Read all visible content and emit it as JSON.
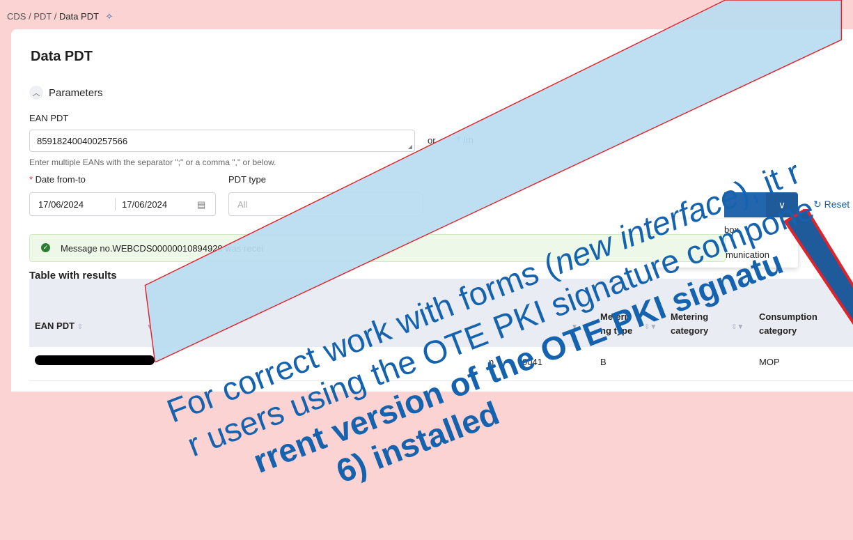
{
  "breadcrumb": {
    "items": [
      "CDS",
      "PDT",
      "Data PDT"
    ],
    "sep": "/"
  },
  "page": {
    "title": "Data PDT"
  },
  "parameters": {
    "section_label": "Parameters",
    "ean_label": "EAN PDT",
    "ean_value": "859182400400257566",
    "or_label": "or",
    "import_label": "Im",
    "hint": "Enter multiple EANs with the separator \";\" or a comma \",\" or below.",
    "date_label": "Date from-to",
    "date_from": "17/06/2024",
    "date_to": "17/06/2024",
    "pdt_type_label": "PDT type",
    "pdt_type_placeholder": "All",
    "reset_label": "Reset"
  },
  "dropdown_menu": {
    "items": [
      "box",
      "tomatic communication"
    ]
  },
  "message": {
    "text": "Message no.WEBCDS00000010894929 was recei"
  },
  "table": {
    "title": "Table with results",
    "headers": {
      "ean": "EAN PDT",
      "metering_type": [
        "Meteri",
        "ng type"
      ],
      "metering_category": [
        "Metering",
        "category"
      ],
      "consumption_category": [
        "Consumption",
        "category"
      ]
    },
    "row": {
      "code": "0041",
      "type": "B",
      "consumption": "MOP",
      "partial": "n"
    }
  },
  "banner": {
    "line1_pre": "For correct work with forms (",
    "line1_italic": "new interface",
    "line1_post": "), it r",
    "line2": "r users using the OTE PKI signature compone",
    "line3": "rrent version of the OTE PKI signatu",
    "line4": "6) installed"
  },
  "colors": {
    "banner_fill": "#b8dcf0",
    "banner_border": "#e2222a",
    "banner_text": "#1563ae",
    "primary": "#1f5a9a"
  }
}
